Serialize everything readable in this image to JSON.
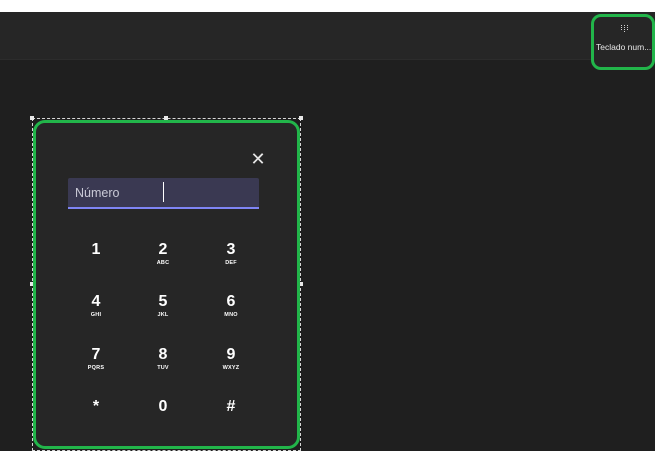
{
  "toolbar": {
    "keypad_toggle_label": "Teclado num...",
    "keypad_toggle_icon": "dialpad-icon"
  },
  "dialpad": {
    "close_icon": "close-icon",
    "close_glyph": "✕",
    "number_placeholder": "Número",
    "keys": [
      {
        "digit": "1",
        "letters": ""
      },
      {
        "digit": "2",
        "letters": "ABC"
      },
      {
        "digit": "3",
        "letters": "DEF"
      },
      {
        "digit": "4",
        "letters": "GHI"
      },
      {
        "digit": "5",
        "letters": "JKL"
      },
      {
        "digit": "6",
        "letters": "MNO"
      },
      {
        "digit": "7",
        "letters": "PQRS"
      },
      {
        "digit": "8",
        "letters": "TUV"
      },
      {
        "digit": "9",
        "letters": "WXYZ"
      },
      {
        "digit": "*",
        "letters": ""
      },
      {
        "digit": "0",
        "letters": ""
      },
      {
        "digit": "#",
        "letters": ""
      }
    ]
  },
  "colors": {
    "highlight": "#22b54a",
    "accent": "#7f85f5",
    "background": "#1f1f1f",
    "panel": "#262626"
  }
}
